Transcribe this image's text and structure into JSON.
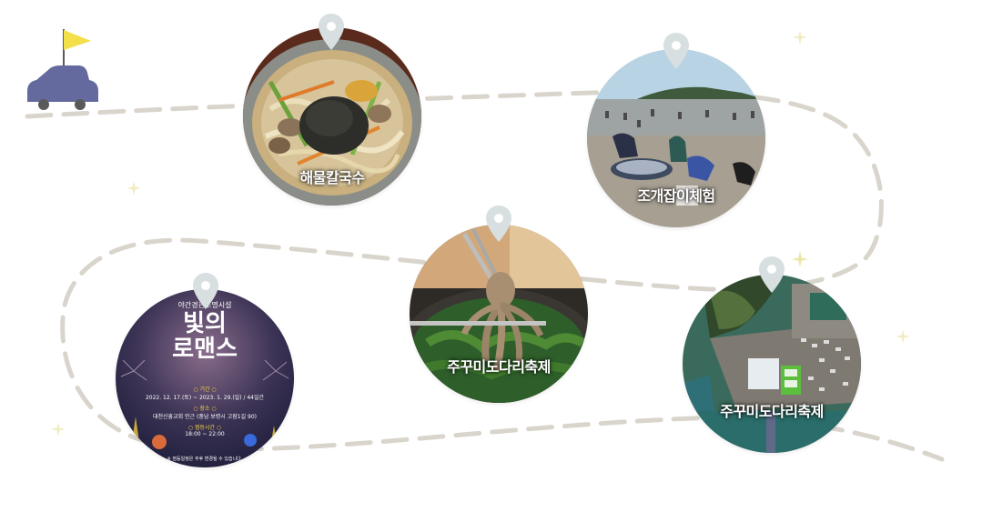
{
  "colors": {
    "route": "#d9d5cc",
    "pin": "#d7dfe0",
    "car": "#646a9e",
    "flag": "#f2df4a"
  },
  "stops": [
    {
      "id": "kalguksu",
      "label": "해물칼국수",
      "icon": "location-pin-icon"
    },
    {
      "id": "clam",
      "label": "조개잡이체험",
      "icon": "location-pin-icon"
    },
    {
      "id": "octopus-pot",
      "label": "주꾸미도다리축제",
      "icon": "location-pin-icon"
    },
    {
      "id": "aerial",
      "label": "주꾸미도다리축제",
      "icon": "location-pin-icon"
    },
    {
      "id": "lights",
      "label": "",
      "icon": "location-pin-icon"
    }
  ],
  "poster": {
    "subtitle": "야간경관조명시설",
    "title_line1": "빛의",
    "title_line2": "로맨스",
    "period_label": "○ 기간 ○",
    "period_value": "2022. 12. 17.(토) ~ 2023. 1. 29.(일) / 44일간",
    "place_label": "○ 장소 ○",
    "place_value": "대천신흥교회 인근 (충남 보령시 고잠1길 90)",
    "time_label": "○ 점등시간 ○",
    "time_value": "18:00 ~ 22:00",
    "footnote": "※ 점등일정은 추후 변경될 수 있습니다."
  }
}
